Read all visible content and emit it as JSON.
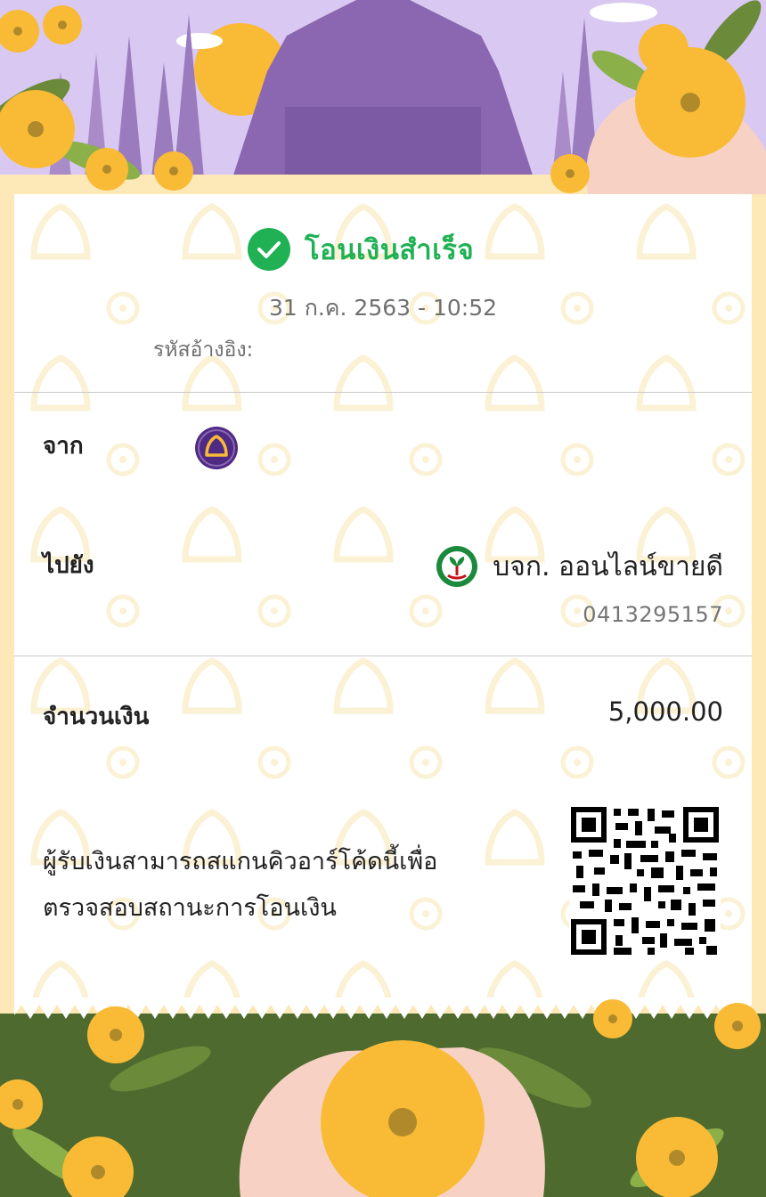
{
  "status": {
    "title": "โอนเงินสำเร็จ",
    "icon": "check-circle-icon",
    "color": "#1fb154"
  },
  "datetime": "31 ก.ค. 2563 - 10:52",
  "reference": {
    "label": "รหัสอ้างอิง:"
  },
  "from": {
    "label": "จาก",
    "bank_icon": "bank-logo-purple-icon"
  },
  "to": {
    "label": "ไปยัง",
    "bank_icon": "kasikorn-bank-logo-icon",
    "name": "บจก. ออนไลน์ขายดี",
    "account": "0413295157"
  },
  "amount": {
    "label": "จำนวนเงิน",
    "value": "5,000.00"
  },
  "qr": {
    "note_line1": "ผู้รับเงินสามารถสแกนคิวอาร์โค้ดนี้เพื่อ",
    "note_line2": "ตรวจสอบสถานะการโอนเงิน",
    "icon": "qr-code-icon"
  },
  "colors": {
    "accent": "#1fb154",
    "temple": "#8a67b0",
    "sky": "#d9c9f2",
    "flower": "#f9bb36",
    "leaf": "#4e6a2e",
    "background": "#fde8b8"
  }
}
